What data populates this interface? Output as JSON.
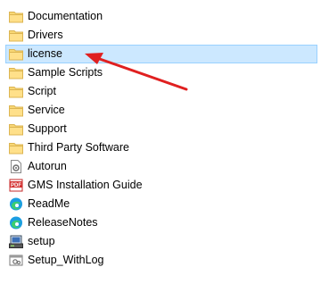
{
  "file_list": {
    "items": [
      {
        "name": "Documentation",
        "type": "folder"
      },
      {
        "name": "Drivers",
        "type": "folder"
      },
      {
        "name": "license",
        "type": "folder",
        "selected": true
      },
      {
        "name": "Sample Scripts",
        "type": "folder"
      },
      {
        "name": "Script",
        "type": "folder"
      },
      {
        "name": "Service",
        "type": "folder"
      },
      {
        "name": "Support",
        "type": "folder"
      },
      {
        "name": "Third Party Software",
        "type": "folder"
      },
      {
        "name": "Autorun",
        "type": "autorun-inf-icon"
      },
      {
        "name": "GMS Installation Guide",
        "type": "pdf-icon"
      },
      {
        "name": "ReadMe",
        "type": "edge-html-icon"
      },
      {
        "name": "ReleaseNotes",
        "type": "edge-html-icon"
      },
      {
        "name": "setup",
        "type": "setup-exe-icon"
      },
      {
        "name": "Setup_WithLog",
        "type": "batch-file-icon"
      }
    ]
  },
  "colors": {
    "selection_bg": "#cce8ff",
    "selection_border": "#99d1ff",
    "folder": "#f8d775",
    "arrow": "#e02020"
  }
}
